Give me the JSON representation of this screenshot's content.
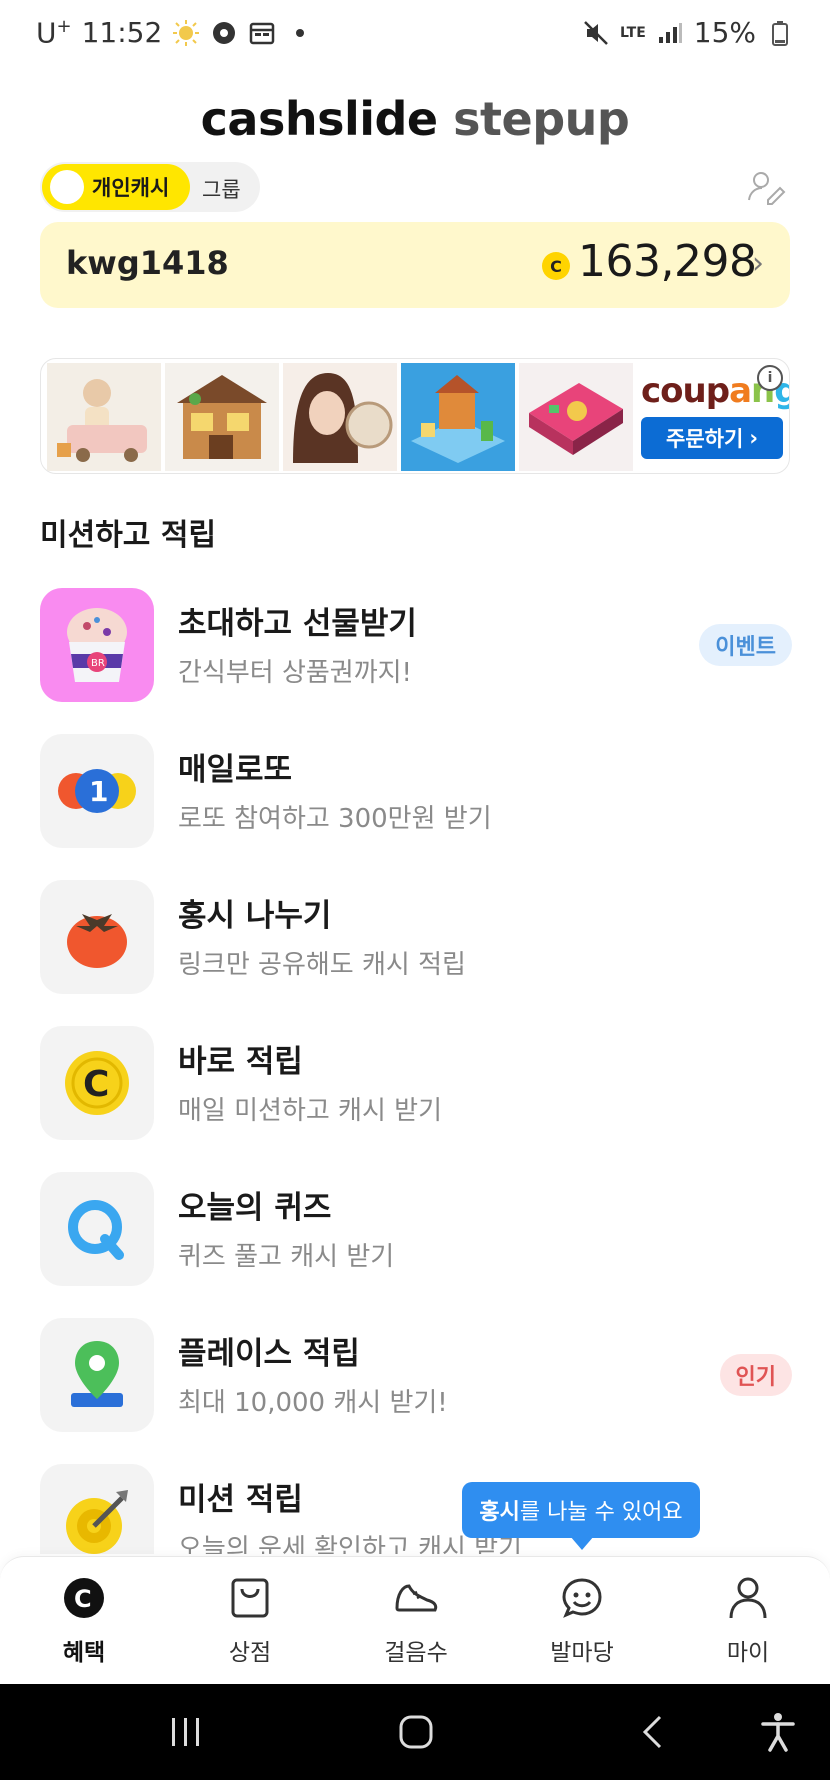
{
  "status_bar": {
    "carrier": "U",
    "carrier_sup": "+",
    "time": "11:52",
    "network": "LTE",
    "battery": "15%"
  },
  "header": {
    "brand_main": "cashslide",
    "brand_sub": "stepup"
  },
  "cash_toggle": {
    "active_label": "개인캐시",
    "other_label": "그룹"
  },
  "balance_card": {
    "username": "kwg1418",
    "coin_symbol": "C",
    "amount": "163,298",
    "arrow": "›"
  },
  "ad": {
    "brand_parts": [
      "coup",
      "a",
      "n",
      "g"
    ],
    "button_label": "주문하기",
    "button_arrow": "›",
    "info_symbol": "i"
  },
  "section": {
    "title": "미션하고 적립"
  },
  "missions": [
    {
      "title": "초대하고 선물받기",
      "subtitle": "간식부터 상품권까지!",
      "badge": "이벤트"
    },
    {
      "title": "매일로또",
      "subtitle": "로또 참여하고 300만원 받기",
      "badge": ""
    },
    {
      "title": "홍시 나누기",
      "subtitle": "링크만 공유해도 캐시 적립",
      "badge": ""
    },
    {
      "title": "바로 적립",
      "subtitle": "매일 미션하고 캐시 받기",
      "badge": ""
    },
    {
      "title": "오늘의 퀴즈",
      "subtitle": "퀴즈 풀고 캐시 받기",
      "badge": ""
    },
    {
      "title": "플레이스 적립",
      "subtitle": "최대 10,000 캐시 받기!",
      "badge": "인기"
    },
    {
      "title": "미션 적립",
      "subtitle": "오늘의 운세 확인하고 캐시 받기",
      "badge": ""
    }
  ],
  "tooltip": {
    "highlight": "홍시",
    "text": "를 나눌 수 있어요"
  },
  "bottom_nav": [
    {
      "label": "혜택",
      "icon": "benefit-coin-icon",
      "active": true
    },
    {
      "label": "상점",
      "icon": "shopping-bag-icon",
      "active": false
    },
    {
      "label": "걸음수",
      "icon": "sneaker-icon",
      "active": false
    },
    {
      "label": "발마당",
      "icon": "smile-chat-icon",
      "active": false
    },
    {
      "label": "마이",
      "icon": "person-icon",
      "active": false
    }
  ],
  "colors": {
    "accent_yellow": "#ffe600",
    "card_yellow": "#fff8cc",
    "event_blue": "#4a90d9",
    "hot_red": "#e05454",
    "tooltip_blue": "#2f8ef0"
  }
}
